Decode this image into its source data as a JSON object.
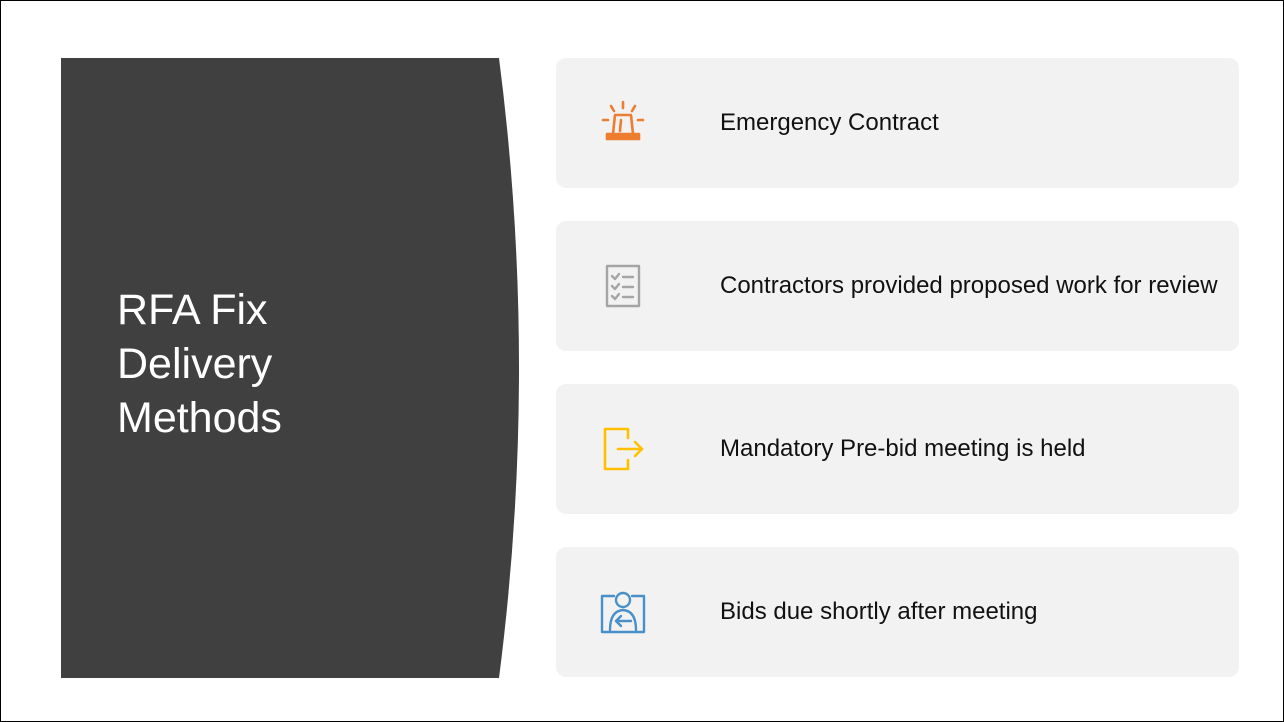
{
  "slide": {
    "title": "RFA Fix\nDelivery\nMethods"
  },
  "items": [
    {
      "label": "Emergency Contract",
      "icon": "siren-icon",
      "color": "#ed7d31"
    },
    {
      "label": "Contractors provided proposed work for review",
      "icon": "checklist-icon",
      "color": "#a5a5a5"
    },
    {
      "label": "Mandatory Pre-bid meeting is held",
      "icon": "enter-door-icon",
      "color": "#ffc000"
    },
    {
      "label": "Bids due shortly after meeting",
      "icon": "user-signin-icon",
      "color": "#4a90c8"
    }
  ],
  "colors": {
    "title_panel": "#404040",
    "card_background": "#f2f2f2"
  }
}
